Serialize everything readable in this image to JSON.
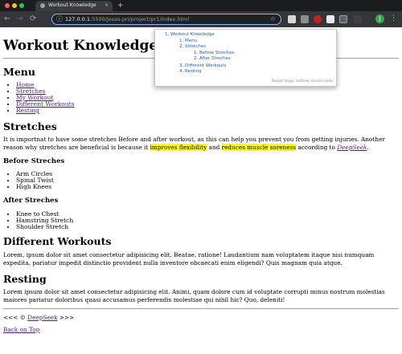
{
  "browser": {
    "tab_title": "Workout Knowledge",
    "tab_close": "×",
    "new_tab": "+",
    "url_host": "127.0.0.1",
    "url_path": ":5500/joses-pri/project/pr1/index.html",
    "avatar_initial": "J",
    "icons": {
      "back": "←",
      "forward": "→",
      "reload": "⟳",
      "info": "ⓘ",
      "bookmark": "☆",
      "menu": "⋮"
    },
    "accent_color": "#8ab4f8"
  },
  "page": {
    "title": "Workout Knowledge",
    "menu": {
      "heading": "Menu",
      "items": [
        "Home",
        "Stretches",
        "My Workout",
        "Different Workouts",
        "Resting"
      ]
    },
    "stretches": {
      "heading": "Stretches",
      "para_part1": "It is importnat to have some stretches Before and after workout, as this can help you prevent you from getting injuries. Another reason why stretches are beneficial is because it",
      "highlight1": "improves flexibility",
      "para_part2": " and ",
      "highlight2": "reduces muscle soreness",
      "para_part3": " according to ",
      "source_link": "DeepSeek",
      "para_end": ".",
      "highlight_color": "#ffff00",
      "before": {
        "heading": "Before Streches",
        "items": [
          "Arm Circles",
          "Spinal Twist",
          "High Knees"
        ]
      },
      "after": {
        "heading": "After Streches",
        "items": [
          "Knee to Chest",
          "Hamstring Stretch",
          "Shoulder Stretch"
        ]
      }
    },
    "different_workouts": {
      "heading": "Different Workouts",
      "text": "Lorem, ipsum dolor sit amet consectetur adipisicing elit. Beatae, ratione! Laudantium nam voluptatem itaque nisi numquam expedita, pariatur impedit distinctio provident nulla inventore obcaecati enim eligendi? Quis magnam quia atque."
    },
    "resting": {
      "heading": "Resting",
      "text": "Lorem ipsum dolor sit amet consectetur adipisicing elit. Animi, quam dolore cum id voluptate corrupti minus nostrum molestias maiores pariatur doloribus quasi accusamus perferendis molestiae qui nihil hic? Quo, deleniti!"
    },
    "footer": {
      "prefix": "<<< © ",
      "link": "DeepSeek",
      "suffix": " >>>",
      "back_to_top": "Back on Top"
    }
  },
  "outline_popup": {
    "items": [
      {
        "num": "1.",
        "label": "Workout Knowledge"
      },
      {
        "num": "1.",
        "label": "Menu"
      },
      {
        "num": "2.",
        "label": "Stretches"
      },
      {
        "num": "1.",
        "label": "Before Streches"
      },
      {
        "num": "2.",
        "label": "After Streches"
      },
      {
        "num": "3.",
        "label": "Different Workouts"
      },
      {
        "num": "4.",
        "label": "Resting"
      }
    ],
    "footer": "Report bugs, outliner source code"
  }
}
